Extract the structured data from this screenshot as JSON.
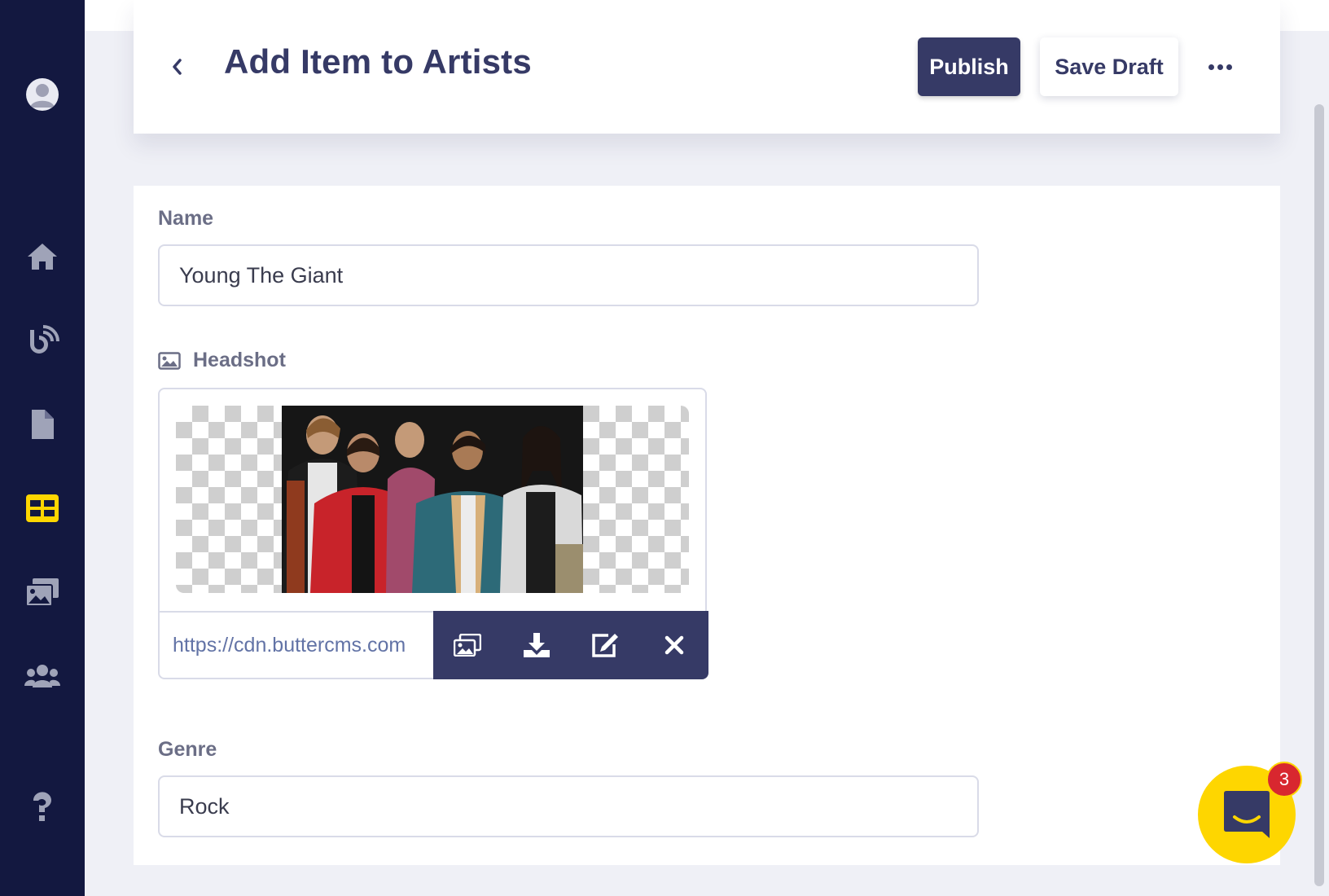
{
  "header": {
    "title": "Add Item to Artists",
    "publish_label": "Publish",
    "save_draft_label": "Save Draft"
  },
  "fields": {
    "name": {
      "label": "Name",
      "value": "Young The Giant"
    },
    "headshot": {
      "label": "Headshot",
      "url": "https://cdn.buttercms.com"
    },
    "genre": {
      "label": "Genre",
      "value": "Rock"
    }
  },
  "sidebar": {
    "items": [
      "avatar",
      "home-icon",
      "blog-icon",
      "pages-icon",
      "collections-icon",
      "media-library-icon",
      "users-icon",
      "help-icon"
    ],
    "active": "collections-icon",
    "active_color": "#fed600"
  },
  "chat": {
    "badge_count": "3"
  },
  "colors": {
    "sidebar": "#131840",
    "primary": "#363a66",
    "chat": "#fed600",
    "badge": "#d8272f"
  }
}
